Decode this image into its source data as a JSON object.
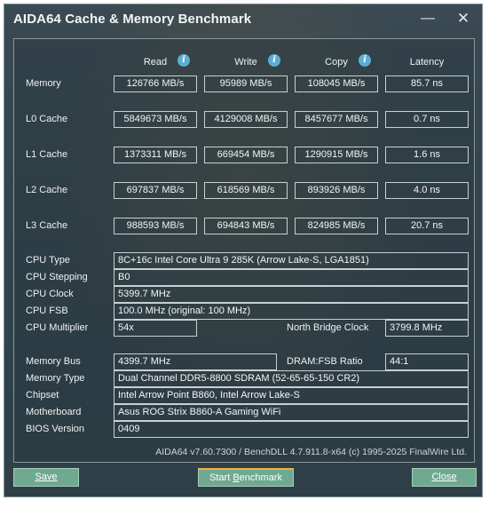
{
  "window": {
    "title": "AIDA64 Cache & Memory Benchmark",
    "minimize_glyph": "—",
    "close_glyph": "✕"
  },
  "columns": {
    "read": "Read",
    "write": "Write",
    "copy": "Copy",
    "latency": "Latency",
    "info_glyph": "i"
  },
  "bench_rows": [
    {
      "label": "Memory",
      "read": "126766 MB/s",
      "write": "95989 MB/s",
      "copy": "108045 MB/s",
      "latency": "85.7 ns"
    },
    {
      "label": "L0 Cache",
      "read": "5849673 MB/s",
      "write": "4129008 MB/s",
      "copy": "8457677 MB/s",
      "latency": "0.7 ns"
    },
    {
      "label": "L1 Cache",
      "read": "1373311 MB/s",
      "write": "669454 MB/s",
      "copy": "1290915 MB/s",
      "latency": "1.6 ns"
    },
    {
      "label": "L2 Cache",
      "read": "697837 MB/s",
      "write": "618569 MB/s",
      "copy": "893926 MB/s",
      "latency": "4.0 ns"
    },
    {
      "label": "L3 Cache",
      "read": "988593 MB/s",
      "write": "694843 MB/s",
      "copy": "824985 MB/s",
      "latency": "20.7 ns"
    }
  ],
  "cpu": {
    "type_label": "CPU Type",
    "type_value": "8C+16c Intel Core Ultra 9 285K  (Arrow Lake-S, LGA1851)",
    "stepping_label": "CPU Stepping",
    "stepping_value": "B0",
    "clock_label": "CPU Clock",
    "clock_value": "5399.7 MHz",
    "fsb_label": "CPU FSB",
    "fsb_value": "100.0 MHz  (original: 100 MHz)",
    "multiplier_label": "CPU Multiplier",
    "multiplier_value": "54x",
    "nb_clock_label": "North Bridge Clock",
    "nb_clock_value": "3799.8 MHz"
  },
  "memory": {
    "bus_label": "Memory Bus",
    "bus_value": "4399.7 MHz",
    "ratio_label": "DRAM:FSB Ratio",
    "ratio_value": "44:1",
    "type_label": "Memory Type",
    "type_value": "Dual Channel DDR5-8800 SDRAM  (52-65-65-150 CR2)",
    "chipset_label": "Chipset",
    "chipset_value": "Intel Arrow Point B860, Intel Arrow Lake-S",
    "motherboard_label": "Motherboard",
    "motherboard_value": "Asus ROG Strix B860-A Gaming WiFi",
    "bios_label": "BIOS Version",
    "bios_value": "0409"
  },
  "footer": {
    "version": "AIDA64 v7.60.7300 / BenchDLL 4.7.911.8-x64  (c) 1995-2025 FinalWire Ltd."
  },
  "buttons": {
    "save": "Save",
    "start_pre": "Start ",
    "start_u": "B",
    "start_post": "enchmark",
    "close": "Close"
  }
}
